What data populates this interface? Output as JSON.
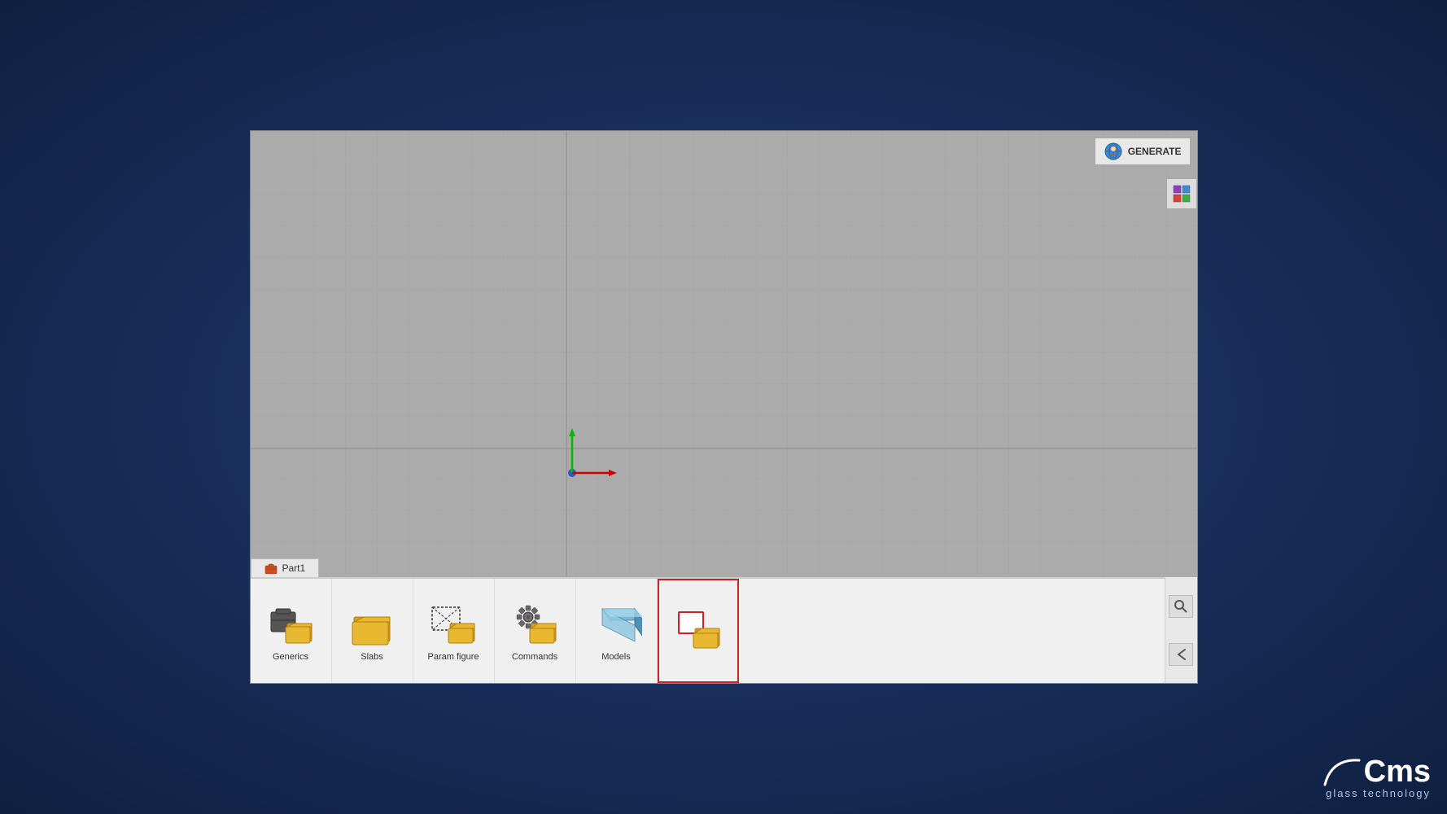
{
  "app": {
    "title": "CMS Glass Technology",
    "window": {
      "generate_label": "GENERATE",
      "part_tab_label": "Part1"
    }
  },
  "categories": [
    {
      "id": "generics",
      "label": "Generics",
      "icon": "briefcase-folders-icon"
    },
    {
      "id": "slabs",
      "label": "Slabs",
      "icon": "slabs-folder-icon"
    },
    {
      "id": "param-figure",
      "label": "Param figure",
      "icon": "param-figure-icon"
    },
    {
      "id": "commands",
      "label": "Commands",
      "icon": "commands-gear-icon"
    },
    {
      "id": "models",
      "label": "Models",
      "icon": "models-slab-icon"
    },
    {
      "id": "last",
      "label": "",
      "icon": "last-item-icon"
    }
  ],
  "toolbar": {
    "search_icon": "search-icon",
    "back_icon": "back-icon",
    "settings_icon": "settings-icon"
  },
  "cms": {
    "name": "Cms",
    "subtitle": "glass technology"
  },
  "axis": {
    "x_color": "#cc0000",
    "y_color": "#00bb00",
    "origin_color": "#3355cc"
  }
}
